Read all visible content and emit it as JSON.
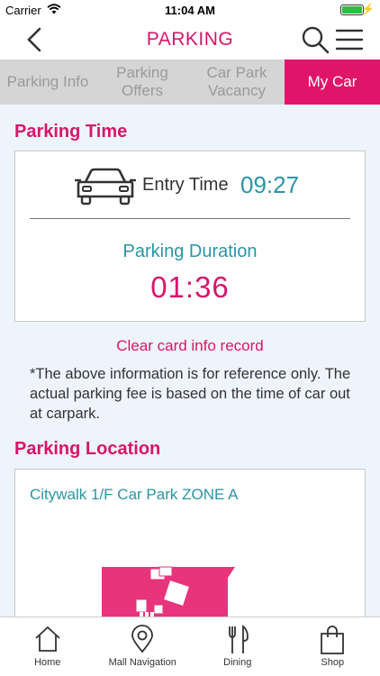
{
  "status_bar": {
    "carrier": "Carrier",
    "time": "11:04 AM"
  },
  "header": {
    "title": "PARKING"
  },
  "tabs": [
    {
      "label": "Parking Info"
    },
    {
      "label": "Parking\nOffers"
    },
    {
      "label": "Car Park\nVacancy"
    },
    {
      "label": "My Car",
      "active": true
    }
  ],
  "parking_time": {
    "title": "Parking Time",
    "entry_label": "Entry Time",
    "entry_time": "09:27",
    "duration_label": "Parking Duration",
    "duration": "01:36"
  },
  "clear_link": "Clear card info record",
  "note": "*The above information is for reference only. The actual parking fee is based on the time of car out at carpark.",
  "parking_location": {
    "title": "Parking Location",
    "name": "Citywalk 1/F Car Park ZONE A"
  },
  "bottom_nav": [
    {
      "label": "Home",
      "icon": "home-icon"
    },
    {
      "label": "Mall Navigation",
      "icon": "location-pin-icon"
    },
    {
      "label": "Dining",
      "icon": "fork-knife-icon"
    },
    {
      "label": "Shop",
      "icon": "shopping-bag-icon"
    }
  ],
  "colors": {
    "accent": "#d6166b",
    "teal": "#2a95a4",
    "tab_active_bg": "#e0156a"
  }
}
